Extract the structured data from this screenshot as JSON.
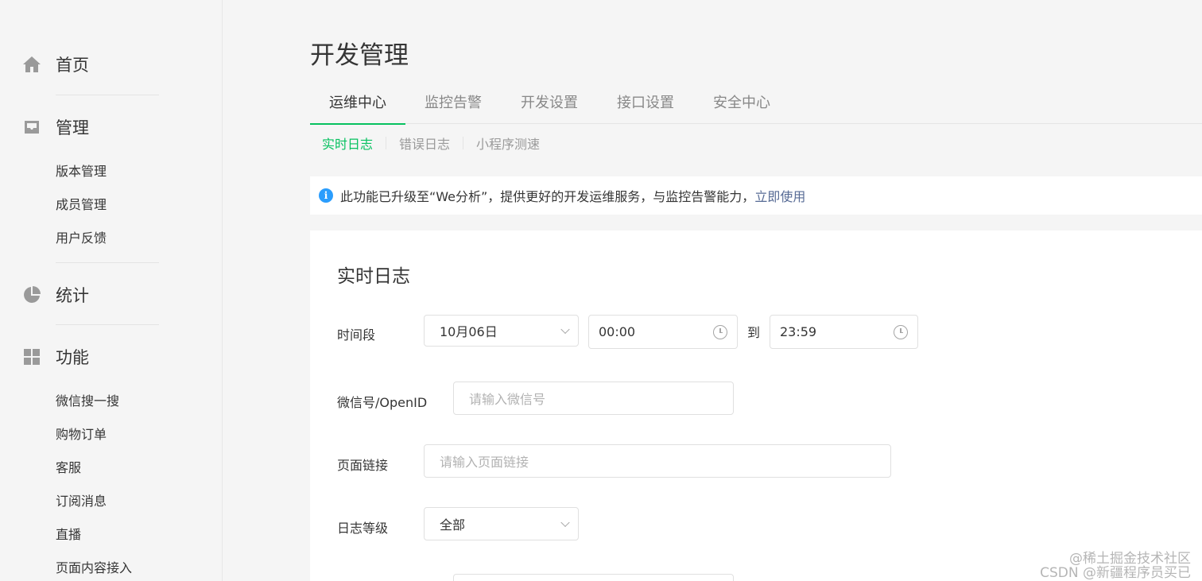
{
  "sidebar": {
    "home": {
      "label": "首页",
      "icon": "home-icon"
    },
    "manage": {
      "label": "管理",
      "icon": "inbox-icon",
      "items": [
        "版本管理",
        "成员管理",
        "用户反馈"
      ]
    },
    "stats": {
      "label": "统计",
      "icon": "pie-chart-icon"
    },
    "features": {
      "label": "功能",
      "icon": "grid-icon",
      "items": [
        "微信搜一搜",
        "购物订单",
        "客服",
        "订阅消息",
        "直播",
        "页面内容接入"
      ]
    }
  },
  "page": {
    "title": "开发管理"
  },
  "tabs": [
    "运维中心",
    "监控告警",
    "开发设置",
    "接口设置",
    "安全中心"
  ],
  "subtabs": [
    "实时日志",
    "错误日志",
    "小程序测速"
  ],
  "notice": {
    "text": "此功能已升级至“We分析”，提供更好的开发运维服务，与监控告警能力，",
    "link": "立即使用"
  },
  "card": {
    "title": "实时日志",
    "time_range": {
      "label": "时间段",
      "date": "10月06日",
      "start": "00:00",
      "to": "到",
      "end": "23:59"
    },
    "wechat_id": {
      "label": "微信号/OpenID",
      "placeholder": "请输入微信号"
    },
    "page_link": {
      "label": "页面链接",
      "placeholder": "请输入页面链接"
    },
    "log_level": {
      "label": "日志等级",
      "value": "全部"
    }
  },
  "watermarks": [
    "@稀土掘金技术社区",
    "CSDN @新疆程序员买已"
  ],
  "colors": {
    "accent": "#07c160",
    "link": "#576b95",
    "info": "#2a9dfd"
  }
}
